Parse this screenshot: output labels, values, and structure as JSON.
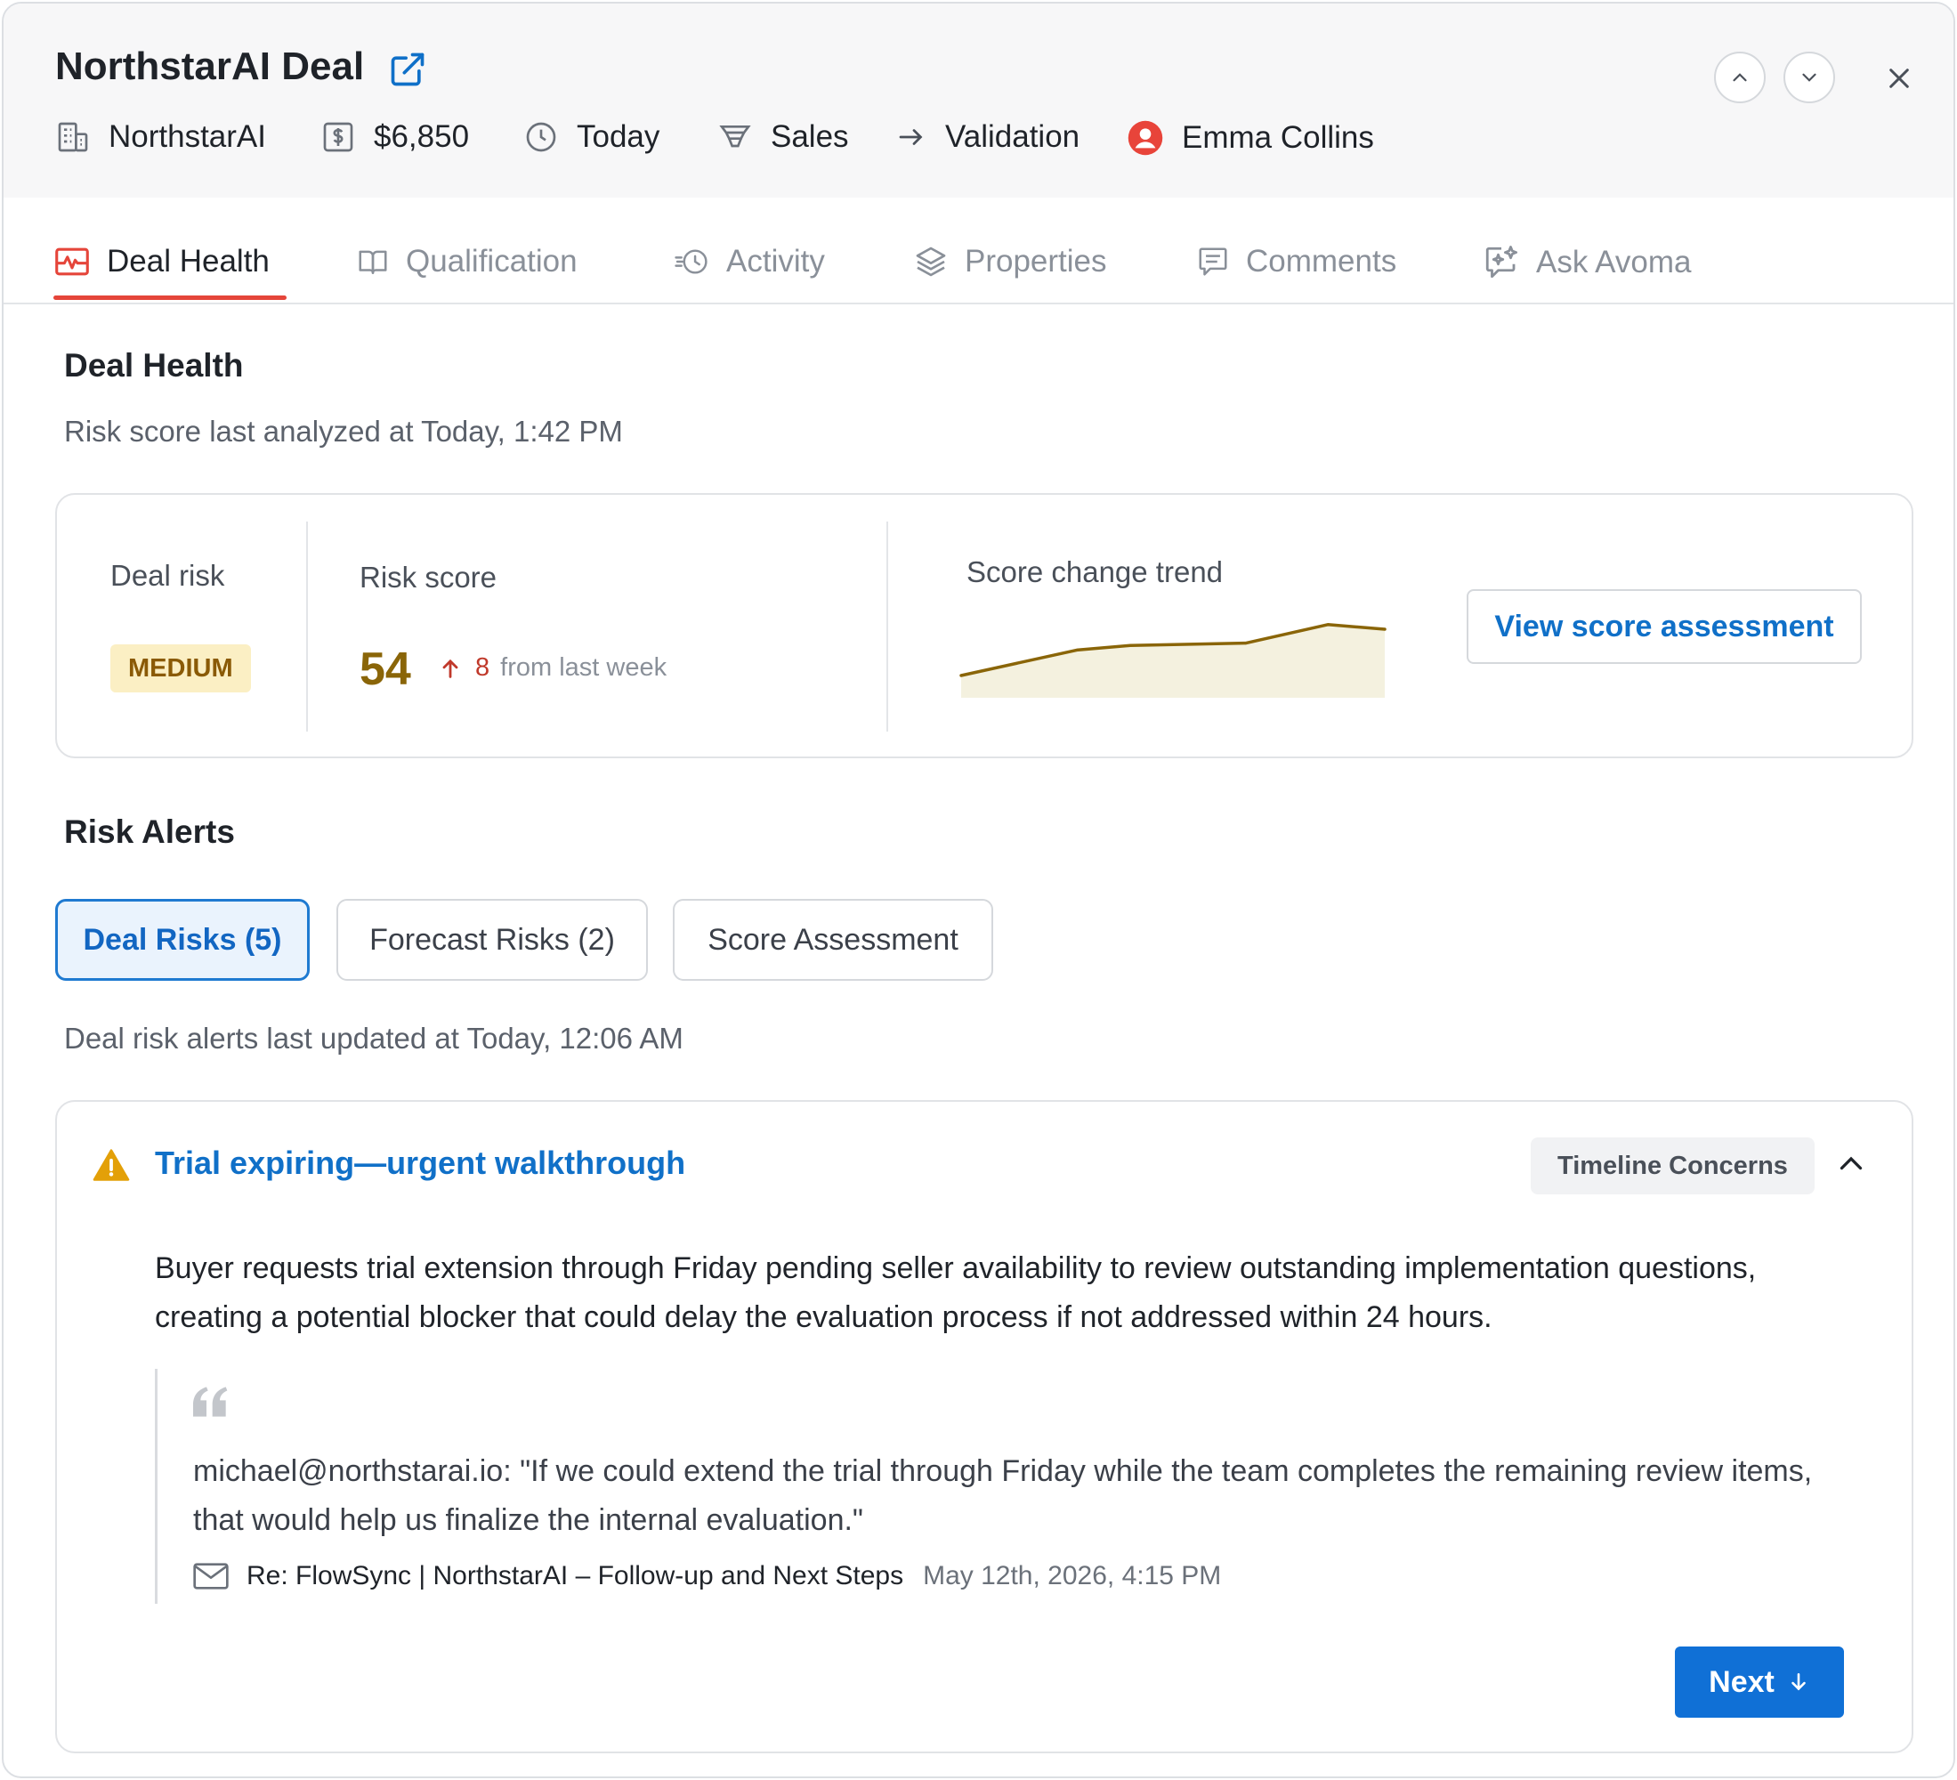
{
  "header": {
    "title": "NorthstarAI Deal",
    "company": "NorthstarAI",
    "amount": "$6,850",
    "close_date": "Today",
    "pipeline": "Sales",
    "stage": "Validation",
    "owner": "Emma Collins"
  },
  "tabs": [
    {
      "label": "Deal Health",
      "icon": "heart-pulse-icon",
      "active": true
    },
    {
      "label": "Qualification",
      "icon": "book-icon"
    },
    {
      "label": "Activity",
      "icon": "history-icon"
    },
    {
      "label": "Properties",
      "icon": "layers-icon"
    },
    {
      "label": "Comments",
      "icon": "comment-icon"
    },
    {
      "label": "Ask Avoma",
      "icon": "sparkle-chat-icon"
    }
  ],
  "deal_health": {
    "heading": "Deal Health",
    "analyzed_text": "Risk score last analyzed at Today, 1:42 PM",
    "deal_risk_label": "Deal risk",
    "deal_risk_value": "MEDIUM",
    "risk_score_label": "Risk score",
    "risk_score_value": "54",
    "delta_value": "8",
    "delta_text": "from last week",
    "trend_label": "Score change trend",
    "trend_values": [
      10,
      32,
      36,
      38,
      54,
      50
    ],
    "view_button": "View score assessment"
  },
  "risk_alerts": {
    "heading": "Risk Alerts",
    "filters": [
      "Deal Risks (5)",
      "Forecast Risks (2)",
      "Score Assessment"
    ],
    "updated_text": "Deal risk alerts last updated at Today, 12:06 AM"
  },
  "alert": {
    "title": "Trial expiring—urgent walkthrough",
    "tag": "Timeline Concerns",
    "body": "Buyer requests trial extension through Friday pending seller availability to review outstanding implementation questions, creating a potential blocker that could delay the evaluation process if not addressed within 24 hours.",
    "quote": "michael@northstarai.io: \"If we could extend the trial through Friday while the team completes the remaining review items, that would help us finalize the internal evaluation.\"",
    "source_subject": "Re: FlowSync | NorthstarAI – Follow-up and Next Steps",
    "source_date": "May 12th, 2026, 4:15 PM",
    "next_button": "Next"
  },
  "colors": {
    "accent_blue": "#1070d6",
    "tab_active": "#e5453a",
    "medium_badge_bg": "#fbefc4",
    "score_color": "#8a6508",
    "delta_red": "#c0392b",
    "warning": "#e3a008"
  }
}
